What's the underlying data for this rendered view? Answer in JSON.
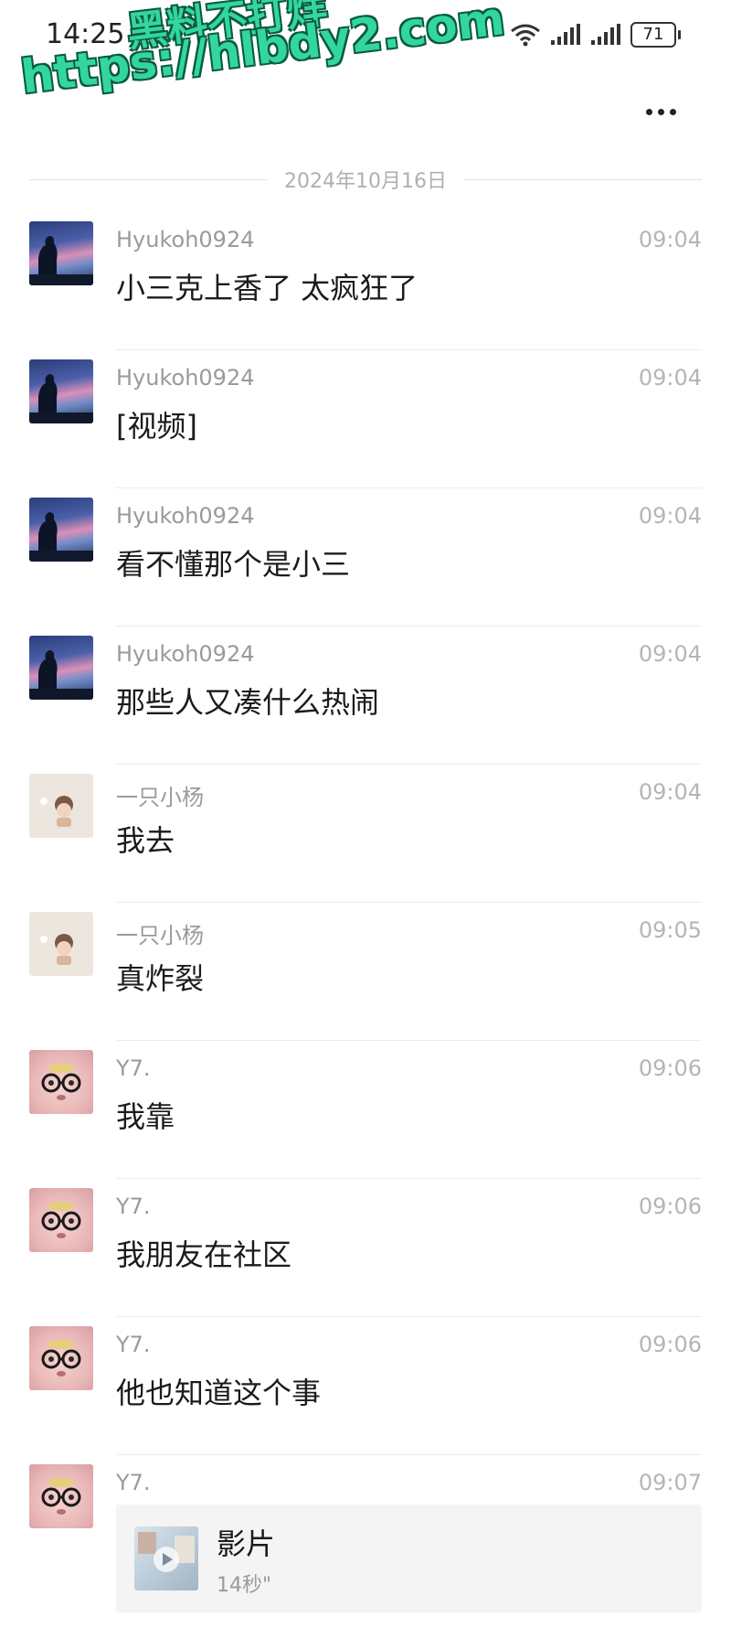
{
  "status_bar": {
    "time": "14:25",
    "battery": "71",
    "icons": [
      "wifi-icon",
      "signal-icon",
      "signal-icon",
      "battery-icon"
    ]
  },
  "watermark": {
    "line1": "黑料不打烊",
    "line2": "https://hlbdy2.com"
  },
  "header": {
    "more_icon": "more-icon"
  },
  "date_divider": "2024年10月16日",
  "messages": [
    {
      "sender": "Hyukoh0924",
      "time": "09:04",
      "text": "小三克上香了 太疯狂了",
      "avatar": "night"
    },
    {
      "sender": "Hyukoh0924",
      "time": "09:04",
      "text": "[视频]",
      "avatar": "night"
    },
    {
      "sender": "Hyukoh0924",
      "time": "09:04",
      "text": "看不懂那个是小三",
      "avatar": "night"
    },
    {
      "sender": "Hyukoh0924",
      "time": "09:04",
      "text": "那些人又凑什么热闹",
      "avatar": "night"
    },
    {
      "sender": "一只小杨",
      "time": "09:04",
      "text": "我去",
      "avatar": "cream"
    },
    {
      "sender": "一只小杨",
      "time": "09:05",
      "text": "真炸裂",
      "avatar": "cream"
    },
    {
      "sender": "Y7.",
      "time": "09:06",
      "text": "我靠",
      "avatar": "pink"
    },
    {
      "sender": "Y7.",
      "time": "09:06",
      "text": "我朋友在社区",
      "avatar": "pink"
    },
    {
      "sender": "Y7.",
      "time": "09:06",
      "text": "他也知道这个事",
      "avatar": "pink"
    }
  ],
  "last_message": {
    "sender": "Y7.",
    "time": "09:07",
    "video_title": "影片",
    "video_duration": "14秒\"",
    "avatar": "pink"
  },
  "colors": {
    "watermark": "#33d6a0",
    "sender": "#9a9a9a",
    "divider": "#ececec"
  }
}
